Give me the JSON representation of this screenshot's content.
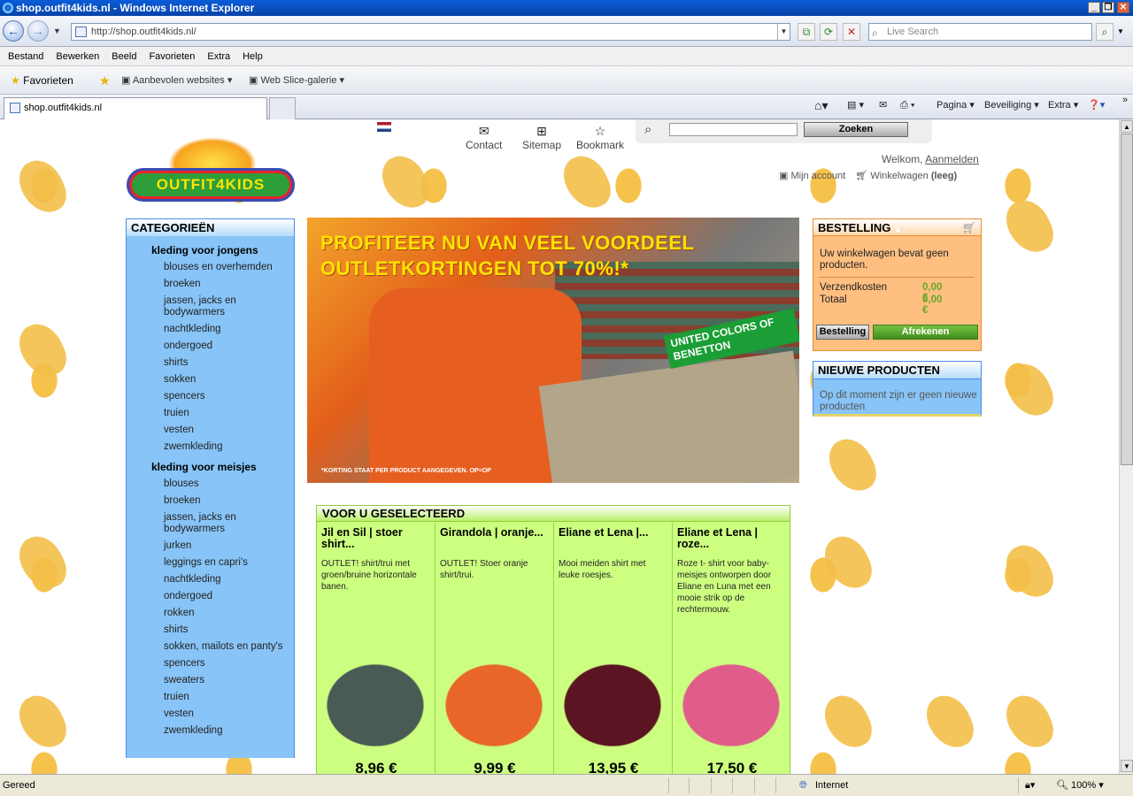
{
  "window": {
    "title": "shop.outfit4kids.nl - Windows Internet Explorer"
  },
  "address": {
    "url": "http://shop.outfit4kids.nl/",
    "search_placeholder": "Live Search"
  },
  "menu": [
    "Bestand",
    "Bewerken",
    "Beeld",
    "Favorieten",
    "Extra",
    "Help"
  ],
  "favbar": {
    "favorites": "Favorieten",
    "suggested": "Aanbevolen websites",
    "webslice": "Web Slice-galerie"
  },
  "tab": {
    "title": "shop.outfit4kids.nl"
  },
  "commandbar": {
    "page": "Pagina",
    "security": "Beveiliging",
    "tools": "Extra"
  },
  "page": {
    "topnav": {
      "contact": "Contact",
      "sitemap": "Sitemap",
      "bookmark": "Bookmark",
      "search_button": "Zoeken"
    },
    "logo": "OUTFIT4KIDS",
    "welcome": "Welkom,",
    "login": "Aanmelden",
    "account": "Mijn account",
    "cart": "Winkelwagen",
    "cart_state": "(leeg)",
    "categories": {
      "title": "CATEGORIEËN",
      "boys": {
        "label": "kleding voor jongens",
        "items": [
          "blouses en overhemden",
          "broeken",
          "jassen, jacks en bodywarmers",
          "nachtkleding",
          "ondergoed",
          "shirts",
          "sokken",
          "spencers",
          "truien",
          "vesten",
          "zwemkleding"
        ]
      },
      "girls": {
        "label": "kleding voor meisjes",
        "items": [
          "blouses",
          "broeken",
          "jassen, jacks en bodywarmers",
          "jurken",
          "leggings en capri's",
          "nachtkleding",
          "ondergoed",
          "rokken",
          "shirts",
          "sokken, mailots en panty's",
          "spencers",
          "sweaters",
          "truien",
          "vesten",
          "zwemkleding"
        ]
      }
    },
    "banner": {
      "line1": "PROFITEER NU VAN VEEL VOORDEEL",
      "line2": "OUTLETKORTINGEN TOT 70%!*",
      "brand": "UNITED COLORS OF BENETTON",
      "footnote": "*KORTING STAAT PER PRODUCT AANGEGEVEN. OP=OP"
    },
    "selected": {
      "title": "VOOR U GESELECTEERD",
      "products": [
        {
          "name": "Jil en Sil | stoer shirt...",
          "desc": "OUTLET! shirt/trui met groen/bruine horizontale banen.",
          "price": "8,96 €",
          "color": "#4a5a55"
        },
        {
          "name": "Girandola | oranje...",
          "desc": "OUTLET! Stoer oranje shirt/trui.",
          "price": "9,99 €",
          "color": "#e8662a"
        },
        {
          "name": "Eliane et Lena |...",
          "desc": "Mooi meiden shirt met leuke roesjes.",
          "price": "13,95 €",
          "color": "#5a1422"
        },
        {
          "name": "Eliane et Lena | roze...",
          "desc": "Roze t- shirt voor baby-meisjes ontworpen door Eliane en Luna met een mooie strik op de rechtermouw.",
          "price": "17,50 €",
          "color": "#e05c8a"
        }
      ]
    },
    "order": {
      "title": "BESTELLING",
      "empty": "Uw winkelwagen bevat geen producten.",
      "shipping_label": "Verzendkosten",
      "shipping": "0,00 €",
      "total_label": "Totaal",
      "total": "0,00 €",
      "btn_order": "Bestelling",
      "btn_checkout": "Afrekenen"
    },
    "new": {
      "title": "NIEUWE PRODUCTEN",
      "empty": "Op dit moment zijn er geen nieuwe producten"
    }
  },
  "status": {
    "text": "Gereed",
    "zone": "Internet",
    "zoom": "100%"
  }
}
